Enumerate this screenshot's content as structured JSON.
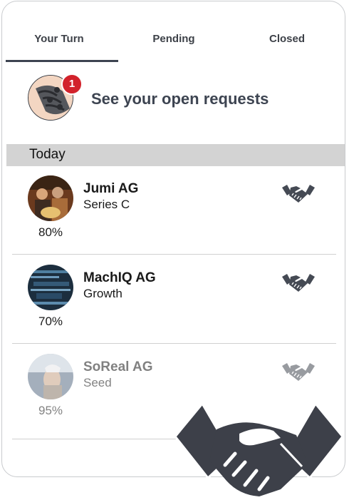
{
  "tabs": [
    {
      "label": "Your Turn",
      "active": true
    },
    {
      "label": "Pending",
      "active": false
    },
    {
      "label": "Closed",
      "active": false
    }
  ],
  "requests": {
    "badge_count": "1",
    "label": "See your open requests"
  },
  "section": {
    "title": "Today"
  },
  "deals": [
    {
      "name": "Jumi AG",
      "stage": "Series C",
      "percent": "80%",
      "icon": "handshake-icon",
      "faded": false
    },
    {
      "name": "MachIQ AG",
      "stage": "Growth",
      "percent": "70%",
      "icon": "handshake-icon",
      "faded": false
    },
    {
      "name": "SoReal AG",
      "stage": "Seed",
      "percent": "95%",
      "icon": "handshake-icon",
      "faded": true
    }
  ],
  "colors": {
    "text_dark": "#3d4451",
    "icon": "#454a54",
    "badge": "#d2222b",
    "section_bg": "#d3d3d3",
    "divider": "#d0d0d0"
  },
  "overlay_icon": "handshake-icon"
}
